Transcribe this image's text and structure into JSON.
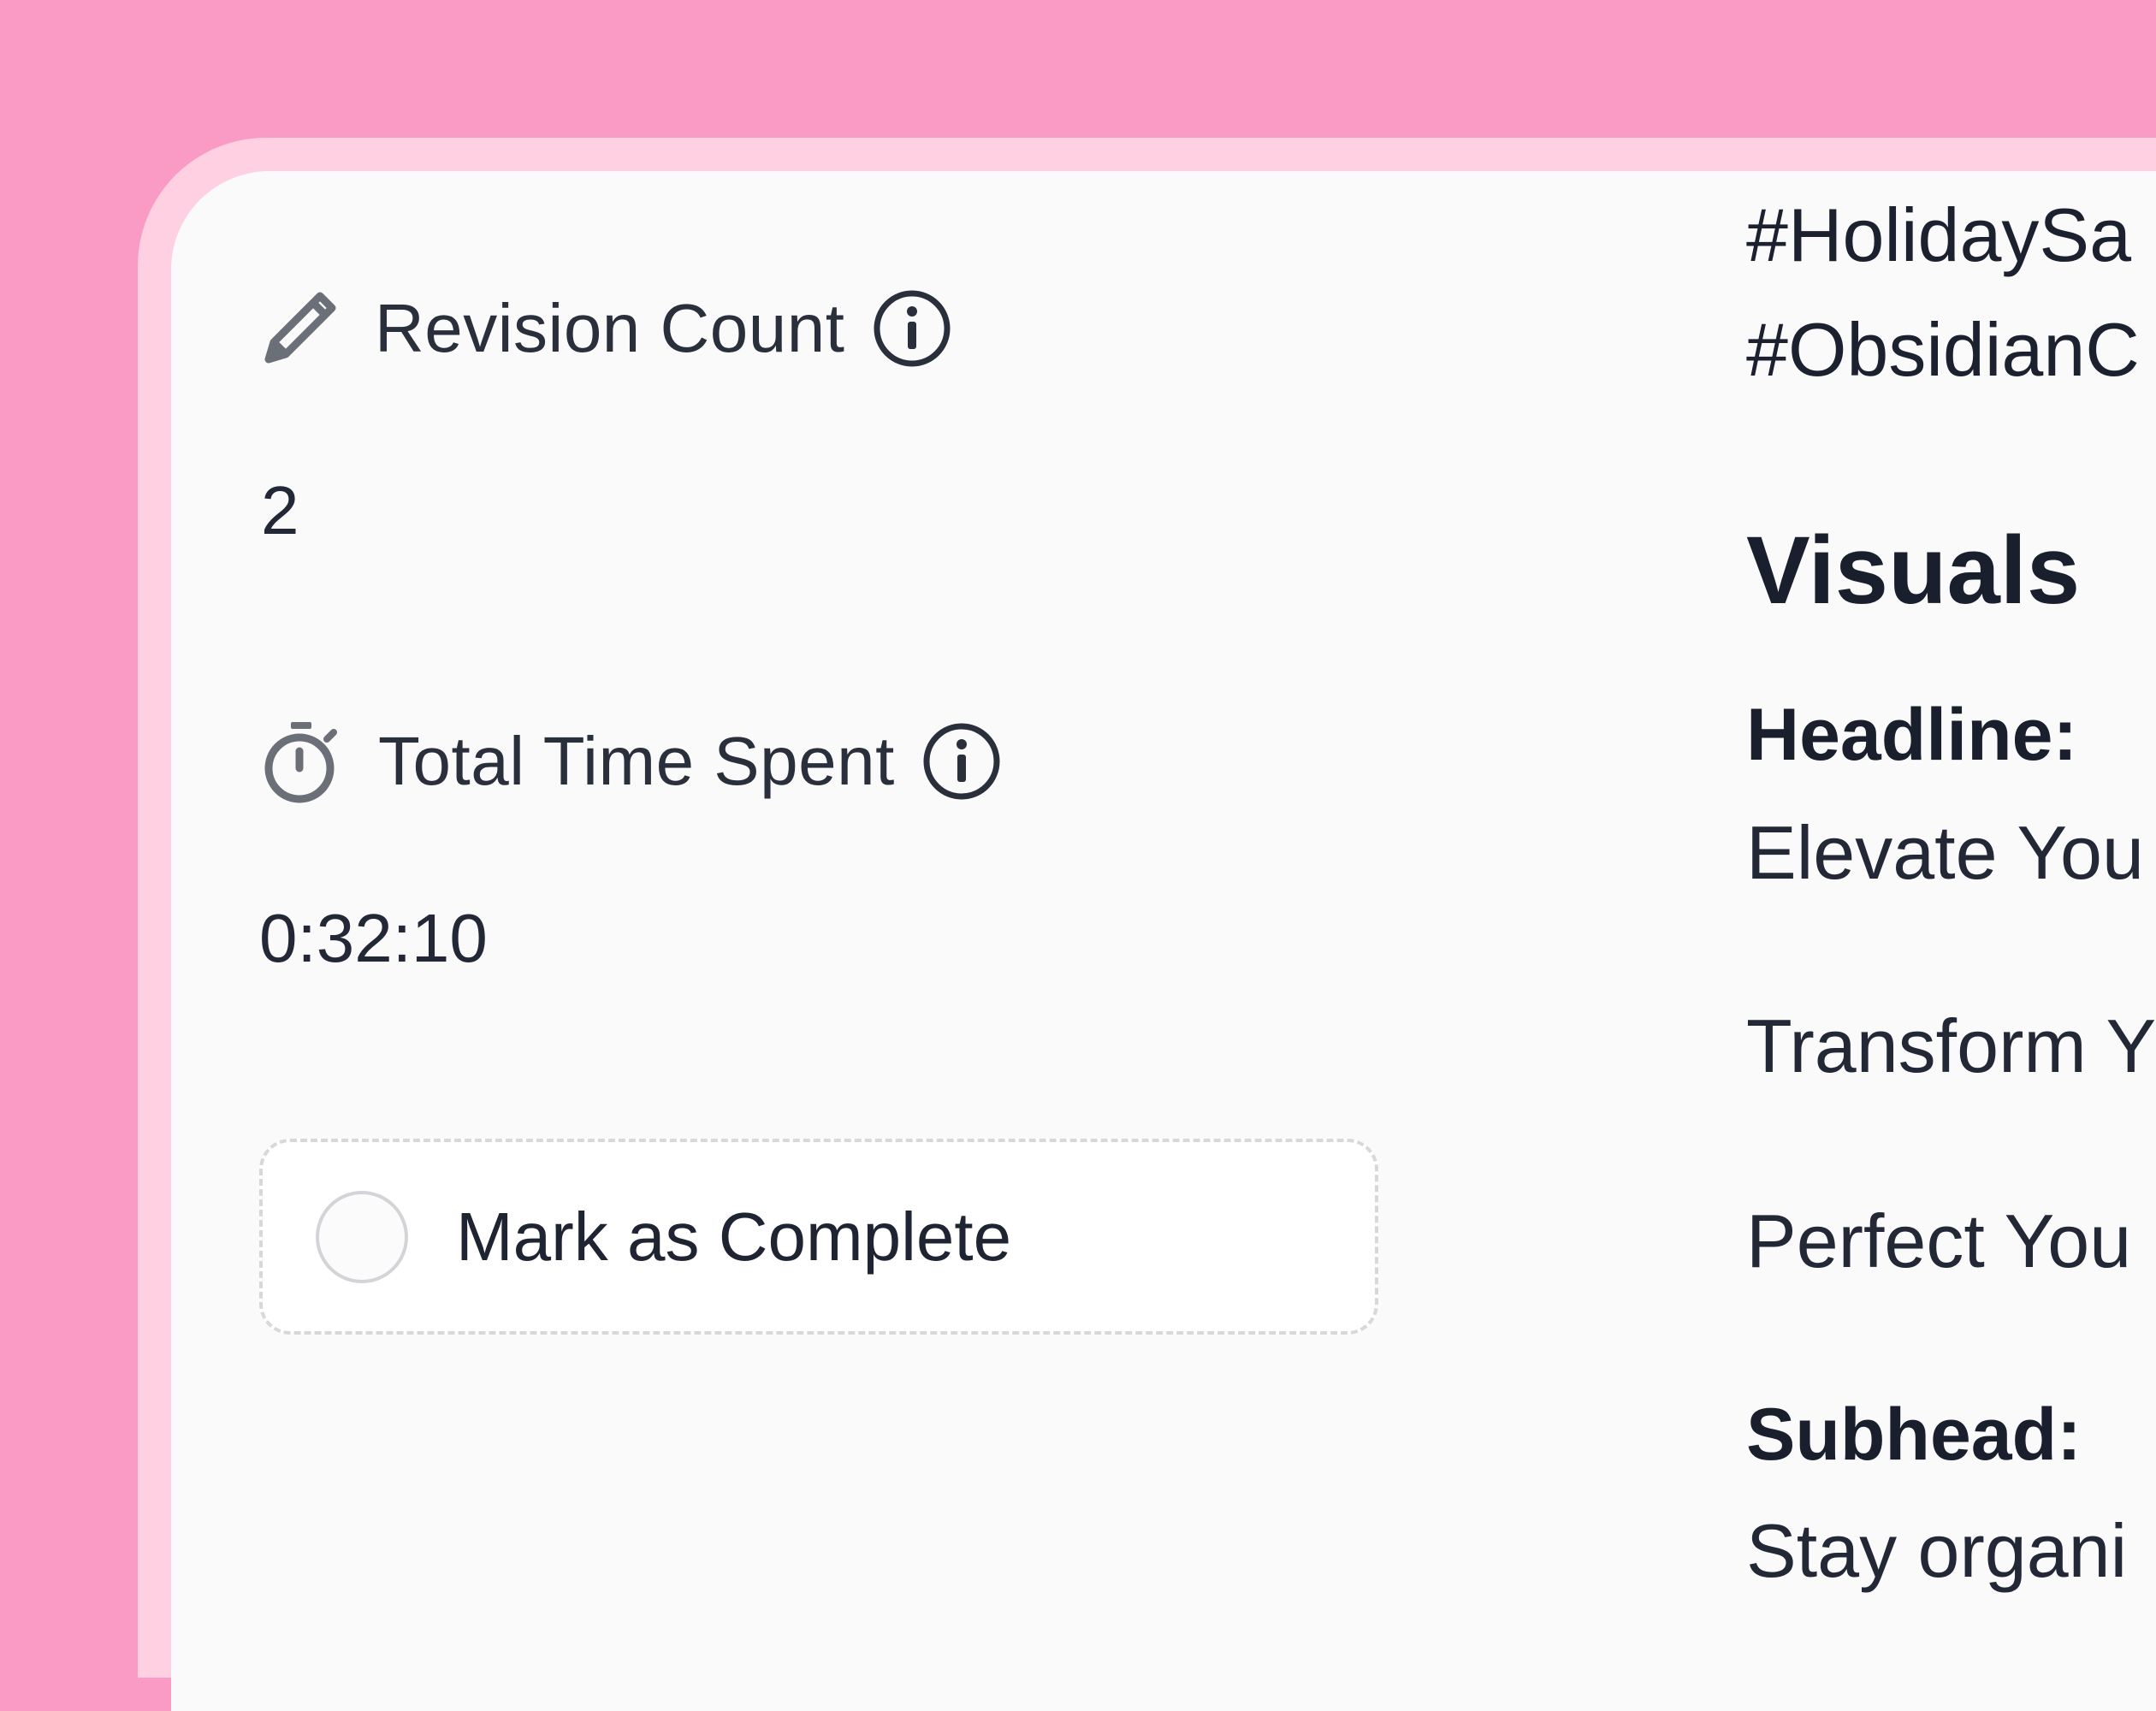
{
  "fields": {
    "revision_count": {
      "label": "Revision Count",
      "value": "2",
      "icon": "pencil-icon"
    },
    "total_time_spent": {
      "label": "Total Time Spent",
      "value": "0:32:10",
      "icon": "stopwatch-icon"
    }
  },
  "complete_toggle": {
    "label": "Mark as Complete",
    "checked": false
  },
  "content": {
    "hashtags": [
      "#HolidaySa",
      "#ObsidianC"
    ],
    "visuals_heading": "Visuals",
    "headline_label": "Headline:",
    "headline_options": [
      "Elevate You",
      "Transform Y",
      "Perfect You"
    ],
    "subhead_label": "Subhead:",
    "subhead_text": "Stay organi"
  },
  "colors": {
    "background": "#f99bc5",
    "frame": "#ffcfe2",
    "panel": "#fafafa",
    "text": "#1f2433",
    "icon": "#6b6f78"
  }
}
